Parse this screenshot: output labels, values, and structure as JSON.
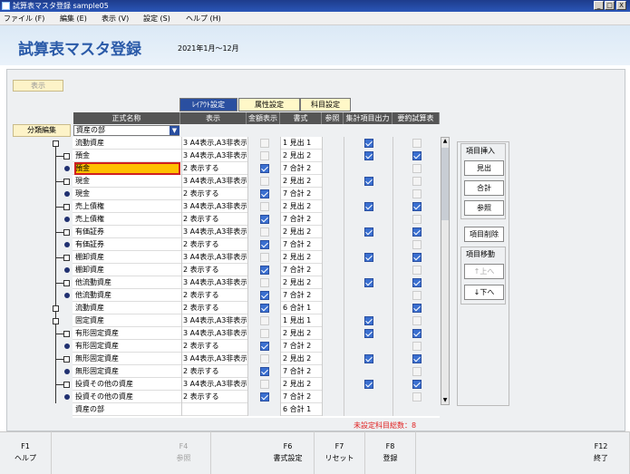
{
  "window": {
    "title": "試算表マスタ登録 sample05",
    "controls": [
      "_",
      "□",
      "X"
    ]
  },
  "menu": [
    "ファイル (F)",
    "編集 (E)",
    "表示 (V)",
    "設定 (S)",
    "ヘルプ (H)"
  ],
  "header": {
    "title": "試算表マスタ登録",
    "period": "2021年1月～12月"
  },
  "view_button": "表示",
  "tabs": [
    "ﾚｲｱｳﾄ設定",
    "属性設定",
    "科目設定"
  ],
  "classify_button": "分類編集",
  "columns": [
    "正式名称",
    "表示",
    "金額表示",
    "書式",
    "参照",
    "集計項目出力",
    "要約試算表"
  ],
  "name_select": "資産の部",
  "rows": [
    {
      "name": "流動資産",
      "show": "3 A4表示,A3非表示",
      "amount": "dim",
      "fmt": "1 見出 1",
      "agg": "on",
      "sum": "dim"
    },
    {
      "name": "預金",
      "show": "3 A4表示,A3非表示",
      "amount": "dim",
      "fmt": "2 見出 2",
      "agg": "on",
      "sum": "on"
    },
    {
      "name": "預金",
      "show": "2 表示する",
      "amount": "on",
      "fmt": "7 合計 2",
      "agg": "",
      "sum": "dim",
      "selected": true
    },
    {
      "name": "現金",
      "show": "3 A4表示,A3非表示",
      "amount": "dim",
      "fmt": "2 見出 2",
      "agg": "on",
      "sum": "dim"
    },
    {
      "name": "現金",
      "show": "2 表示する",
      "amount": "on",
      "fmt": "7 合計 2",
      "agg": "",
      "sum": "dim"
    },
    {
      "name": "売上債権",
      "show": "3 A4表示,A3非表示",
      "amount": "dim",
      "fmt": "2 見出 2",
      "agg": "on",
      "sum": "on"
    },
    {
      "name": "売上債権",
      "show": "2 表示する",
      "amount": "on",
      "fmt": "7 合計 2",
      "agg": "",
      "sum": "dim"
    },
    {
      "name": "有価証券",
      "show": "3 A4表示,A3非表示",
      "amount": "dim",
      "fmt": "2 見出 2",
      "agg": "on",
      "sum": "on"
    },
    {
      "name": "有価証券",
      "show": "2 表示する",
      "amount": "on",
      "fmt": "7 合計 2",
      "agg": "",
      "sum": "dim"
    },
    {
      "name": "棚卸資産",
      "show": "3 A4表示,A3非表示",
      "amount": "dim",
      "fmt": "2 見出 2",
      "agg": "on",
      "sum": "on"
    },
    {
      "name": "棚卸資産",
      "show": "2 表示する",
      "amount": "on",
      "fmt": "7 合計 2",
      "agg": "",
      "sum": "dim"
    },
    {
      "name": "他流動資産",
      "show": "3 A4表示,A3非表示",
      "amount": "dim",
      "fmt": "2 見出 2",
      "agg": "on",
      "sum": "on"
    },
    {
      "name": "他流動資産",
      "show": "2 表示する",
      "amount": "on",
      "fmt": "7 合計 2",
      "agg": "",
      "sum": "dim"
    },
    {
      "name": "流動資産",
      "show": "2 表示する",
      "amount": "on",
      "fmt": "6 合計 1",
      "agg": "",
      "sum": "on"
    },
    {
      "name": "固定資産",
      "show": "3 A4表示,A3非表示",
      "amount": "dim",
      "fmt": "1 見出 1",
      "agg": "on",
      "sum": "dim"
    },
    {
      "name": "有形固定資産",
      "show": "3 A4表示,A3非表示",
      "amount": "dim",
      "fmt": "2 見出 2",
      "agg": "on",
      "sum": "on"
    },
    {
      "name": "有形固定資産",
      "show": "2 表示する",
      "amount": "on",
      "fmt": "7 合計 2",
      "agg": "",
      "sum": "dim"
    },
    {
      "name": "無形固定資産",
      "show": "3 A4表示,A3非表示",
      "amount": "dim",
      "fmt": "2 見出 2",
      "agg": "on",
      "sum": "on"
    },
    {
      "name": "無形固定資産",
      "show": "2 表示する",
      "amount": "on",
      "fmt": "7 合計 2",
      "agg": "",
      "sum": "dim"
    },
    {
      "name": "投資その他の資産",
      "show": "3 A4表示,A3非表示",
      "amount": "dim",
      "fmt": "2 見出 2",
      "agg": "on",
      "sum": "on"
    },
    {
      "name": "投資その他の資産",
      "show": "2 表示する",
      "amount": "on",
      "fmt": "7 合計 2",
      "agg": "",
      "sum": "dim"
    },
    {
      "name": "資産の部",
      "show": "",
      "amount": "",
      "fmt": "6 合計 1",
      "agg": "",
      "sum": ""
    }
  ],
  "side": {
    "insert_label": "項目挿入",
    "heading_btn": "見出",
    "total_btn": "合計",
    "ref_btn": "参照",
    "delete_btn": "項目削除",
    "move_label": "項目移動",
    "up_btn": "↑上へ",
    "down_btn": "↓下へ"
  },
  "unset_count": "未設定科目総数：8",
  "fkeys": [
    {
      "key": "F1",
      "label": "ヘルプ",
      "enabled": true
    },
    {
      "key": "F4",
      "label": "参照",
      "enabled": false
    },
    {
      "key": "F6",
      "label": "書式設定",
      "enabled": true
    },
    {
      "key": "F7",
      "label": "リセット",
      "enabled": true
    },
    {
      "key": "F8",
      "label": "登録",
      "enabled": true
    },
    {
      "key": "F12",
      "label": "終了",
      "enabled": true
    }
  ]
}
